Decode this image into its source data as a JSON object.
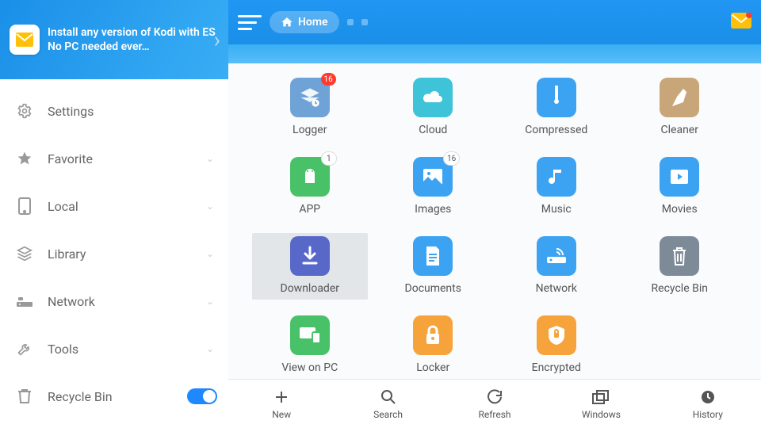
{
  "banner": {
    "text": "Install any version of Kodi with ES No PC needed ever…"
  },
  "sidebar": {
    "items": [
      {
        "label": "Settings"
      },
      {
        "label": "Favorite"
      },
      {
        "label": "Local"
      },
      {
        "label": "Library"
      },
      {
        "label": "Network"
      },
      {
        "label": "Tools"
      },
      {
        "label": "Recycle Bin"
      }
    ]
  },
  "topbar": {
    "home": "Home"
  },
  "tiles": {
    "logger": {
      "label": "Logger",
      "badge": "16",
      "color": "#6fa2d6"
    },
    "cloud": {
      "label": "Cloud",
      "color": "#3ec3d8"
    },
    "compressed": {
      "label": "Compressed",
      "color": "#3ba3f2"
    },
    "cleaner": {
      "label": "Cleaner",
      "color": "#c9a67a"
    },
    "app": {
      "label": "APP",
      "badge": "1",
      "badge_type": "white",
      "color": "#49c168"
    },
    "images": {
      "label": "Images",
      "badge": "16",
      "badge_type": "white",
      "color": "#3ba3f2"
    },
    "music": {
      "label": "Music",
      "color": "#3ba3f2"
    },
    "movies": {
      "label": "Movies",
      "color": "#3ba3f2"
    },
    "downloader": {
      "label": "Downloader",
      "color": "#5868c9"
    },
    "documents": {
      "label": "Documents",
      "color": "#3ba3f2"
    },
    "network": {
      "label": "Network",
      "color": "#3ba3f2"
    },
    "recyclebin": {
      "label": "Recycle Bin",
      "color": "#7d8a97"
    },
    "viewonpc": {
      "label": "View on PC",
      "color": "#49c168"
    },
    "locker": {
      "label": "Locker",
      "color": "#f5a33a"
    },
    "encrypted": {
      "label": "Encrypted",
      "color": "#f5a33a"
    }
  },
  "bottombar": {
    "new": "New",
    "search": "Search",
    "refresh": "Refresh",
    "windows": "Windows",
    "history": "History"
  }
}
